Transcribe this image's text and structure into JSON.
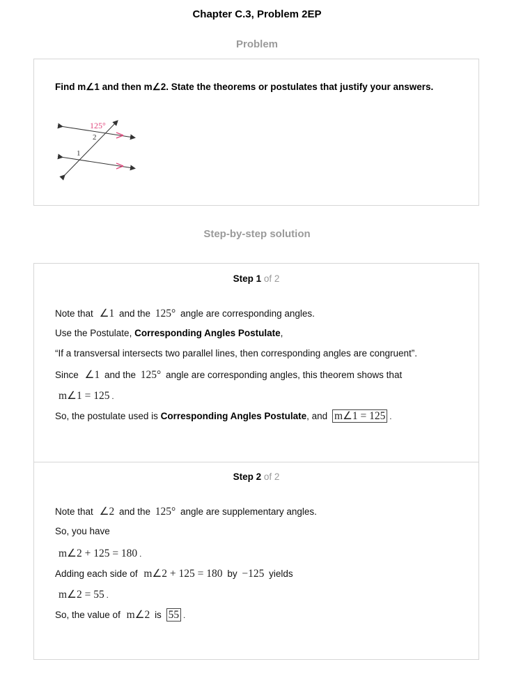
{
  "header": {
    "title": "Chapter C.3, Problem 2EP"
  },
  "problem": {
    "heading": "Problem",
    "text": "Find m∠1 and then m∠2. State the theorems or postulates that justify your answers.",
    "figure": {
      "angle_label": "125°",
      "label_2": "2",
      "label_1": "1",
      "arrow_color": "#e0457b"
    }
  },
  "solution": {
    "heading": "Step-by-step solution",
    "steps": [
      {
        "label": "Step",
        "number": "1",
        "of_text": "of 2",
        "lines": {
          "l1": {
            "a": "Note that",
            "m1": "∠1",
            "b": "and the",
            "m2": "125°",
            "c": "angle are corresponding angles."
          },
          "l2": {
            "a": "Use the Postulate, ",
            "bold": "Corresponding Angles Postulate",
            "c": ","
          },
          "l3": {
            "a": "“If a transversal intersects two parallel lines, then corresponding angles are congruent”."
          },
          "l4": {
            "a": "Since",
            "m1": "∠1",
            "b": "and the",
            "m2": "125°",
            "c": "angle are corresponding angles, this theorem shows that"
          },
          "l5": {
            "m1": "m∠1 = 125"
          },
          "l6": {
            "a": "So, the postulate used is ",
            "bold": "Corresponding Angles Postulate",
            "b": ", and",
            "boxed": "m∠1 = 125"
          }
        }
      },
      {
        "label": "Step",
        "number": "2",
        "of_text": "of 2",
        "lines": {
          "l1": {
            "a": "Note that",
            "m1": "∠2",
            "b": "and the",
            "m2": "125°",
            "c": "angle are supplementary angles."
          },
          "l2": {
            "a": "So, you have"
          },
          "l3": {
            "m1": "m∠2 + 125 = 180"
          },
          "l4": {
            "a": "Adding each side of",
            "m1": "m∠2 + 125 = 180",
            "b": "by",
            "m2": "−125",
            "c": "yields"
          },
          "l5": {
            "m1": "m∠2 = 55"
          },
          "l6": {
            "a": "So, the value of",
            "m1": "m∠2",
            "b": "is",
            "boxed": "55"
          }
        }
      }
    ]
  }
}
